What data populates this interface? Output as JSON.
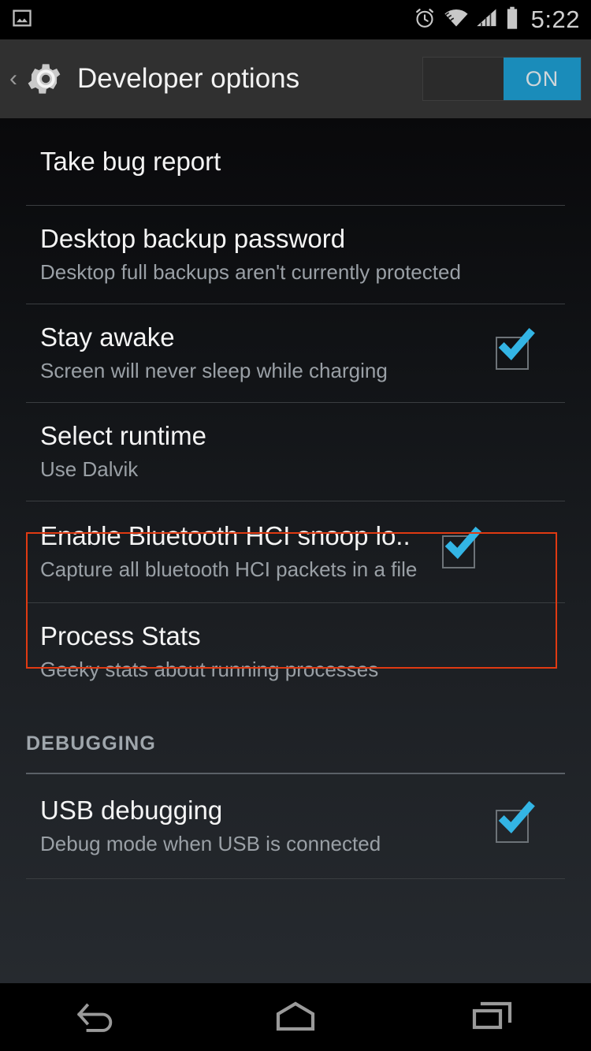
{
  "status_bar": {
    "notification_icon": "screenshot-image-icon",
    "icons": [
      "alarm-clock-icon",
      "wifi-icon",
      "cellular-signal-icon",
      "battery-icon"
    ],
    "time": "5:22"
  },
  "action_bar": {
    "back_label": "‹",
    "icon": "gear-icon",
    "title": "Developer options",
    "toggle_label": "ON",
    "toggle_on": true,
    "toggle_color": "#1a8cba"
  },
  "settings": [
    {
      "title": "Take bug report",
      "subtitle": "",
      "checkbox": false,
      "checked": false
    },
    {
      "title": "Desktop backup password",
      "subtitle": "Desktop full backups aren't currently protected",
      "checkbox": false,
      "checked": false
    },
    {
      "title": "Stay awake",
      "subtitle": "Screen will never sleep while charging",
      "checkbox": true,
      "checked": true
    },
    {
      "title": "Select runtime",
      "subtitle": "Use Dalvik",
      "checkbox": false,
      "checked": false
    },
    {
      "title": "Enable Bluetooth HCI snoop lo..",
      "subtitle": "Capture all bluetooth HCI packets in a file",
      "checkbox": true,
      "checked": true,
      "highlighted": true
    },
    {
      "title": "Process Stats",
      "subtitle": "Geeky stats about running processes",
      "checkbox": false,
      "checked": false
    }
  ],
  "section": {
    "label": "DEBUGGING"
  },
  "debugging_settings": [
    {
      "title": "USB debugging",
      "subtitle": "Debug mode when USB is connected",
      "checkbox": true,
      "checked": true
    }
  ],
  "nav_bar": {
    "back": "back-icon",
    "home": "home-icon",
    "recents": "recents-icon"
  },
  "colors": {
    "accent": "#1a8cba",
    "check": "#33b5e5",
    "highlight": "#e03a12",
    "title_text": "#f4f4f4",
    "sub_text": "#9aa0a6"
  }
}
